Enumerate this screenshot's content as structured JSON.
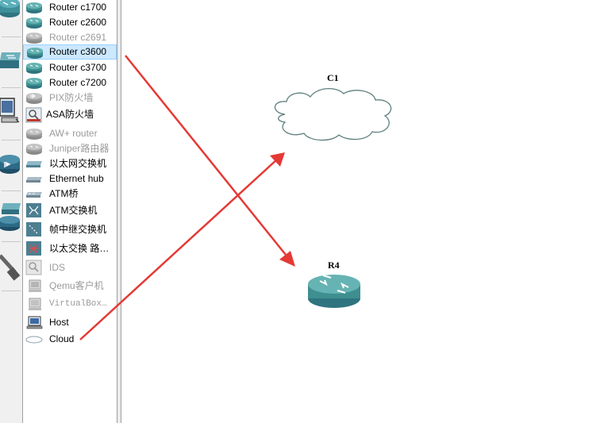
{
  "device_list": {
    "items": [
      {
        "label": "Router c1700",
        "icon": "router-icon",
        "enabled": true,
        "selected": false
      },
      {
        "label": "Router c2600",
        "icon": "router-icon",
        "enabled": true,
        "selected": false
      },
      {
        "label": "Router c2691",
        "icon": "router-icon",
        "enabled": false,
        "selected": false
      },
      {
        "label": "Router c3600",
        "icon": "router-icon",
        "enabled": true,
        "selected": true
      },
      {
        "label": "Router c3700",
        "icon": "router-icon",
        "enabled": true,
        "selected": false
      },
      {
        "label": "Router c7200",
        "icon": "router-icon",
        "enabled": true,
        "selected": false
      },
      {
        "label": "PIX防火墙",
        "icon": "pix-firewall-icon",
        "enabled": false,
        "selected": false
      },
      {
        "label": "ASA防火墙",
        "icon": "asa-firewall-icon",
        "enabled": true,
        "selected": false
      },
      {
        "label": "AW+ router",
        "icon": "router-icon",
        "enabled": false,
        "selected": false
      },
      {
        "label": "Juniper路由器",
        "icon": "router-icon",
        "enabled": false,
        "selected": false
      },
      {
        "label": "以太网交换机",
        "icon": "ethernet-switch-icon",
        "enabled": true,
        "selected": false
      },
      {
        "label": "Ethernet hub",
        "icon": "ethernet-hub-icon",
        "enabled": true,
        "selected": false
      },
      {
        "label": "ATM桥",
        "icon": "atm-bridge-icon",
        "enabled": true,
        "selected": false
      },
      {
        "label": "ATM交换机",
        "icon": "atm-switch-icon",
        "enabled": true,
        "selected": false
      },
      {
        "label": "帧中继交换机",
        "icon": "frame-relay-switch-icon",
        "enabled": true,
        "selected": false
      },
      {
        "label": "以太交换 路…",
        "icon": "ethernet-switch-router-icon",
        "enabled": true,
        "selected": false
      },
      {
        "label": "IDS",
        "icon": "ids-icon",
        "enabled": false,
        "selected": false
      },
      {
        "label": "Qemu客户机",
        "icon": "qemu-guest-icon",
        "enabled": false,
        "selected": false
      },
      {
        "label": "VirtualBox…",
        "icon": "virtualbox-guest-icon",
        "enabled": false,
        "selected": false
      },
      {
        "label": "Host",
        "icon": "host-icon",
        "enabled": true,
        "selected": false
      },
      {
        "label": "Cloud",
        "icon": "cloud-icon",
        "enabled": true,
        "selected": false
      }
    ]
  },
  "categories": [
    {
      "icon": "routers-category-icon"
    },
    {
      "icon": "switches-category-icon"
    },
    {
      "icon": "end-devices-category-icon"
    },
    {
      "icon": "security-devices-category-icon"
    },
    {
      "icon": "all-devices-category-icon"
    },
    {
      "icon": "links-category-icon"
    }
  ],
  "topology": {
    "nodes": [
      {
        "id": "C1",
        "label": "C1",
        "type": "cloud"
      },
      {
        "id": "R4",
        "label": "R4",
        "type": "router"
      }
    ]
  },
  "colors": {
    "selection_bg": "#cce8ff",
    "selection_border": "#99d1ff",
    "router_teal": "#3e8f8f",
    "cloud_stroke": "#5f7f7f",
    "annotation_arrow": "#e53935"
  }
}
